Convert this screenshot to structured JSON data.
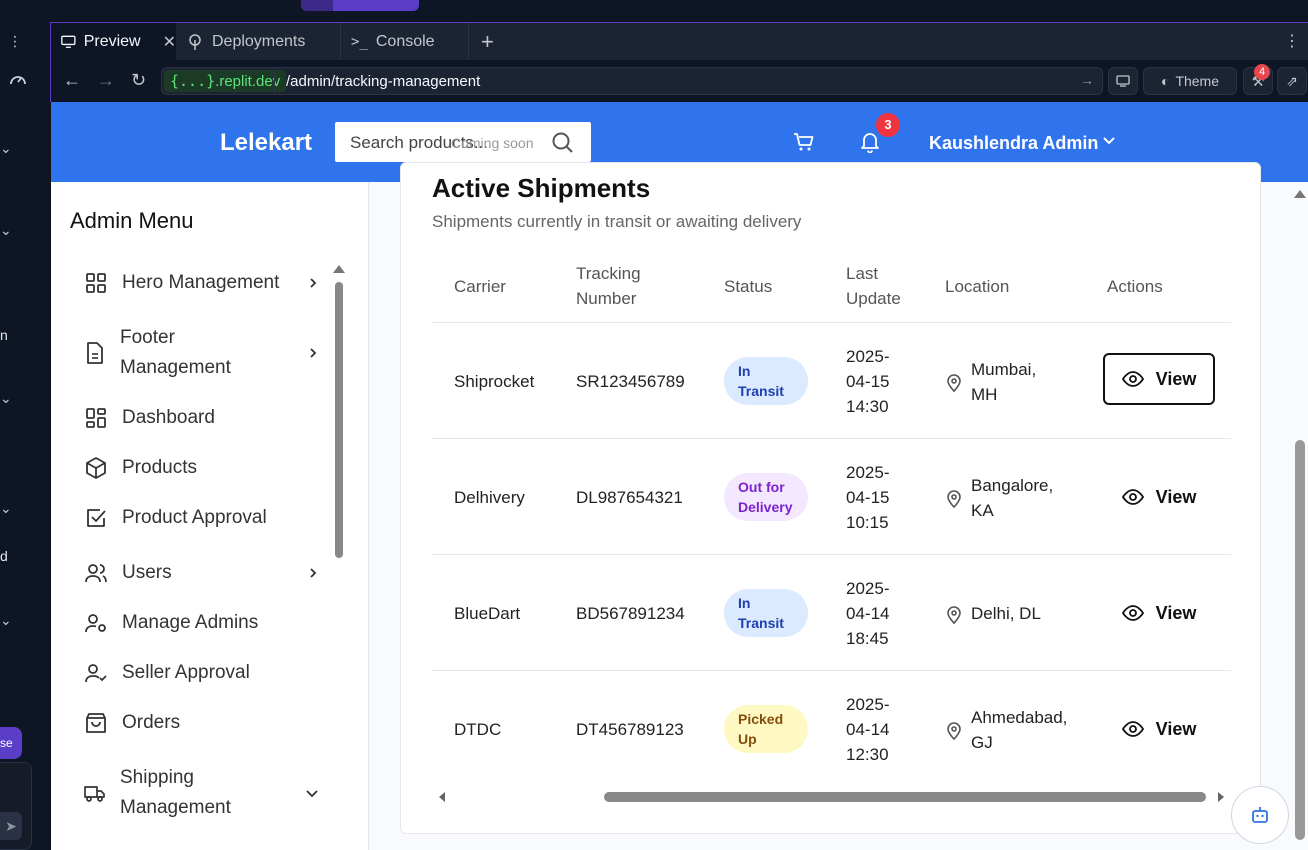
{
  "ide": {
    "tabs": [
      {
        "label": "Preview",
        "icon": "monitor-icon"
      },
      {
        "label": "Deployments",
        "icon": "deploy-icon"
      },
      {
        "label": "Console",
        "icon": "terminal-icon"
      }
    ],
    "url_domain_braces": "{...}",
    "url_domain_base": ".replit.dev",
    "url_path": "/admin/tracking-management",
    "theme_label": "Theme",
    "devtools_badge": "4",
    "cut_texts": [
      "n",
      "d",
      "se"
    ]
  },
  "site": {
    "brand": "Lelekart",
    "search_placeholder": "Search products...",
    "search_soon": "Coming soon",
    "notif_count": "3",
    "user_name": "Kaushlendra Admin",
    "accent": "#2f74ec"
  },
  "sidebar": {
    "title": "Admin Menu",
    "items": [
      {
        "label": "Hero Management",
        "icon": "grid-icon",
        "has_chevron": true
      },
      {
        "label": "Footer Management",
        "icon": "file-icon",
        "has_chevron": true
      },
      {
        "label": "Dashboard",
        "icon": "dashboard-icon",
        "has_chevron": false
      },
      {
        "label": "Products",
        "icon": "box-icon",
        "has_chevron": false
      },
      {
        "label": "Product Approval",
        "icon": "check-square-icon",
        "has_chevron": false
      },
      {
        "label": "Users",
        "icon": "users-icon",
        "has_chevron": true
      },
      {
        "label": "Manage Admins",
        "icon": "user-cog-icon",
        "has_chevron": false
      },
      {
        "label": "Seller Approval",
        "icon": "user-check-icon",
        "has_chevron": false
      },
      {
        "label": "Orders",
        "icon": "bag-icon",
        "has_chevron": false
      },
      {
        "label": "Shipping Management",
        "icon": "truck-icon",
        "has_chevron": true
      }
    ]
  },
  "main": {
    "title": "Active Shipments",
    "subtitle": "Shipments currently in transit or awaiting delivery",
    "columns": [
      "Carrier",
      "Tracking Number",
      "Status",
      "Last Update",
      "Location",
      "Actions"
    ],
    "rows": [
      {
        "carrier": "Shiprocket",
        "tracking": "SR123456789",
        "status": "In Transit",
        "status_kind": "transit",
        "date": "2025-04-15 14:30",
        "location": "Mumbai, MH",
        "action": "View"
      },
      {
        "carrier": "Delhivery",
        "tracking": "DL987654321",
        "status": "Out for Delivery",
        "status_kind": "delivery",
        "date": "2025-04-15 10:15",
        "location": "Bangalore, KA",
        "action": "View"
      },
      {
        "carrier": "BlueDart",
        "tracking": "BD567891234",
        "status": "In Transit",
        "status_kind": "transit",
        "date": "2025-04-14 18:45",
        "location": "Delhi, DL",
        "action": "View"
      },
      {
        "carrier": "DTDC",
        "tracking": "DT456789123",
        "status": "Picked Up",
        "status_kind": "picked",
        "date": "2025-04-14 12:30",
        "location": "Ahmedabad, GJ",
        "action": "View"
      }
    ],
    "status_colors": {
      "transit": {
        "bg": "#dbeafe",
        "fg": "#1e40af"
      },
      "delivery": {
        "bg": "#f3e8ff",
        "fg": "#7e22ce"
      },
      "picked": {
        "bg": "#fef9c3",
        "fg": "#854d0e"
      }
    }
  }
}
